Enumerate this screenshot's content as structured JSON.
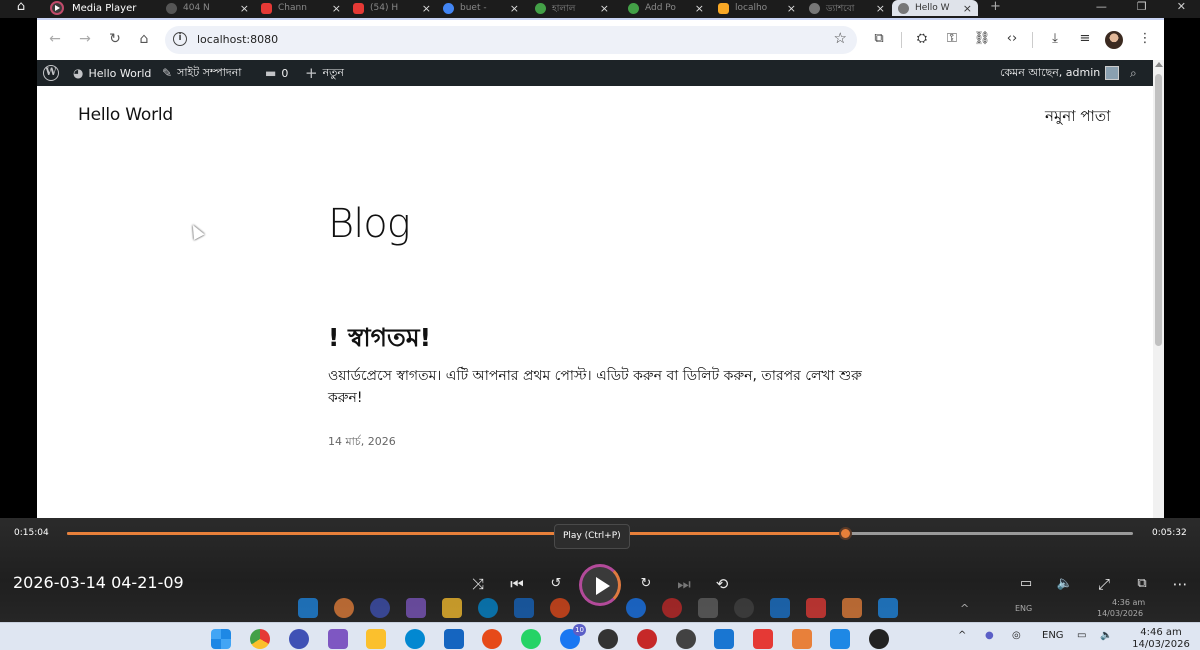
{
  "window": {
    "title": "Media Player"
  },
  "browser": {
    "tabs": [
      {
        "label": "404 N",
        "fav_color": "#555"
      },
      {
        "label": "Chann",
        "fav_color": "#e53935"
      },
      {
        "label": "(54) H",
        "fav_color": "#e53935"
      },
      {
        "label": "buet -",
        "fav_color": "#4285f4"
      },
      {
        "label": "হালাল",
        "fav_color": "#43a047"
      },
      {
        "label": "Add Po",
        "fav_color": "#43a047"
      },
      {
        "label": "localho",
        "fav_color": "#f9a825"
      },
      {
        "label": "ড্যাশবো",
        "fav_color": "#777"
      },
      {
        "label": "Hello W",
        "fav_color": "#777"
      }
    ],
    "url": "localhost:8080"
  },
  "adminbar": {
    "site_name": "Hello World",
    "customize": "সাইট সম্পাদনা",
    "comments_count": "0",
    "new_label": "নতুন",
    "greeting": "কেমন আছেন, admin"
  },
  "site": {
    "title": "Hello World",
    "nav_item": "নমুনা পাতা",
    "page_heading": "Blog",
    "post": {
      "title": "! স্বাগতম!",
      "excerpt": "ওয়ার্ডপ্রেসে স্বাগতম। এটি আপনার প্রথম পোস্ট। এডিট করুন বা ডিলিট করুন, তারপর লেখা শুরু করুন!",
      "date": "14 মার্চ, 2026"
    }
  },
  "player": {
    "elapsed": "0:15:04",
    "remaining": "0:05:32",
    "progress": 0.73,
    "tooltip": "Play (Ctrl+P)",
    "media_title": "2026-03-14 04-21-09",
    "accent_color": "#e8803a"
  },
  "recorded_taskbar": {
    "lang": "ENG",
    "time": "4:36 am",
    "date": "14/03/2026"
  },
  "taskbar": {
    "badge": "10",
    "lang": "ENG",
    "time": "4:46 am",
    "date": "14/03/2026"
  }
}
